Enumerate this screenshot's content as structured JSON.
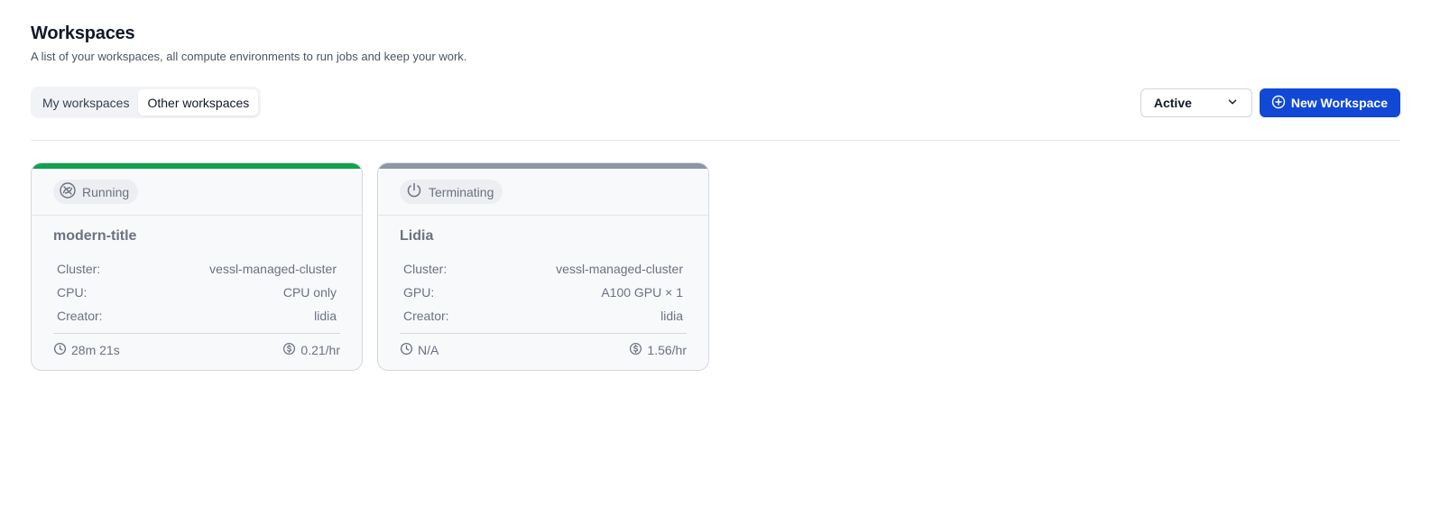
{
  "header": {
    "title": "Workspaces",
    "subtitle": "A list of your workspaces, all compute environments to run jobs and keep your work."
  },
  "tabs": [
    {
      "label": "My workspaces",
      "active": false
    },
    {
      "label": "Other workspaces",
      "active": true
    }
  ],
  "filter": {
    "selected": "Active",
    "icon": "chevron-down-icon"
  },
  "new_button": {
    "label": "New Workspace",
    "icon": "plus-circle-icon"
  },
  "colors": {
    "running": "#12a150",
    "terminating": "#8e96a3",
    "primary": "#1148d6"
  },
  "workspaces": [
    {
      "status": "Running",
      "status_icon": "running-spinner-icon",
      "name": "modern-title",
      "specs": [
        {
          "label": "Cluster:",
          "value": "vessl-managed-cluster"
        },
        {
          "label": "CPU:",
          "value": "CPU only"
        },
        {
          "label": "Creator:",
          "value": "lidia"
        }
      ],
      "duration": "28m 21s",
      "cost": "0.21/hr"
    },
    {
      "status": "Terminating",
      "status_icon": "power-icon",
      "name": "Lidia",
      "specs": [
        {
          "label": "Cluster:",
          "value": "vessl-managed-cluster"
        },
        {
          "label": "GPU:",
          "value": "A100 GPU × 1"
        },
        {
          "label": "Creator:",
          "value": "lidia"
        }
      ],
      "duration": "N/A",
      "cost": "1.56/hr"
    }
  ]
}
